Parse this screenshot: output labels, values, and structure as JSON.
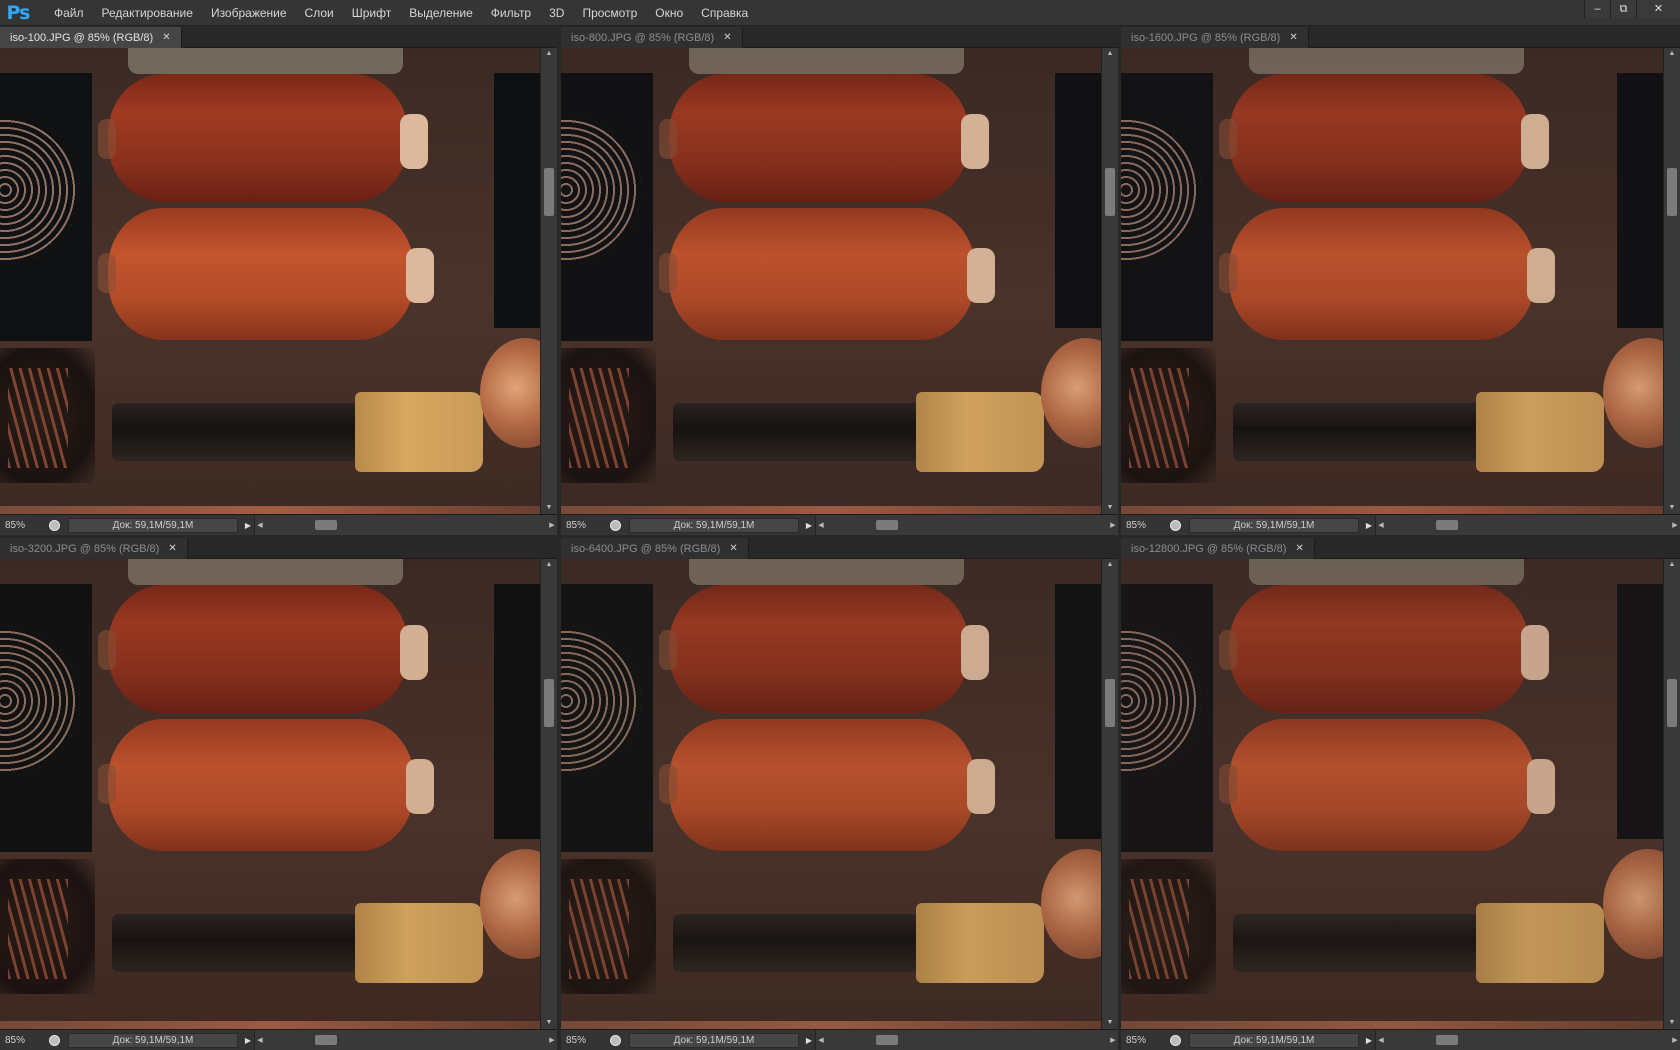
{
  "app": {
    "logo": "Ps",
    "menu": [
      "Файл",
      "Редактирование",
      "Изображение",
      "Слои",
      "Шрифт",
      "Выделение",
      "Фильтр",
      "3D",
      "Просмотр",
      "Окно",
      "Справка"
    ]
  },
  "window_controls": [
    "minimize-icon",
    "restore-icon",
    "close-icon"
  ],
  "documents": [
    {
      "title": "iso-100.JPG @ 85% (RGB/8)",
      "zoom": "85%",
      "doc_info": "Док: 59,1M/59,1M",
      "active": true
    },
    {
      "title": "iso-800.JPG @ 85% (RGB/8)",
      "zoom": "85%",
      "doc_info": "Док: 59,1M/59,1M",
      "active": false
    },
    {
      "title": "iso-1600.JPG @ 85% (RGB/8)",
      "zoom": "85%",
      "doc_info": "Док: 59,1M/59,1M",
      "active": false
    },
    {
      "title": "iso-3200.JPG @ 85% (RGB/8)",
      "zoom": "85%",
      "doc_info": "Док: 59,1M/59,1M",
      "active": false
    },
    {
      "title": "iso-6400.JPG @ 85% (RGB/8)",
      "zoom": "85%",
      "doc_info": "Док: 59,1M/59,1M",
      "active": false
    },
    {
      "title": "iso-12800.JPG @ 85% (RGB/8)",
      "zoom": "85%",
      "doc_info": "Док: 59,1M/59,1M",
      "active": false
    }
  ],
  "colors": {
    "accent": "#31a8ff",
    "menubar": "#353535",
    "panel": "#2c2c2c"
  }
}
